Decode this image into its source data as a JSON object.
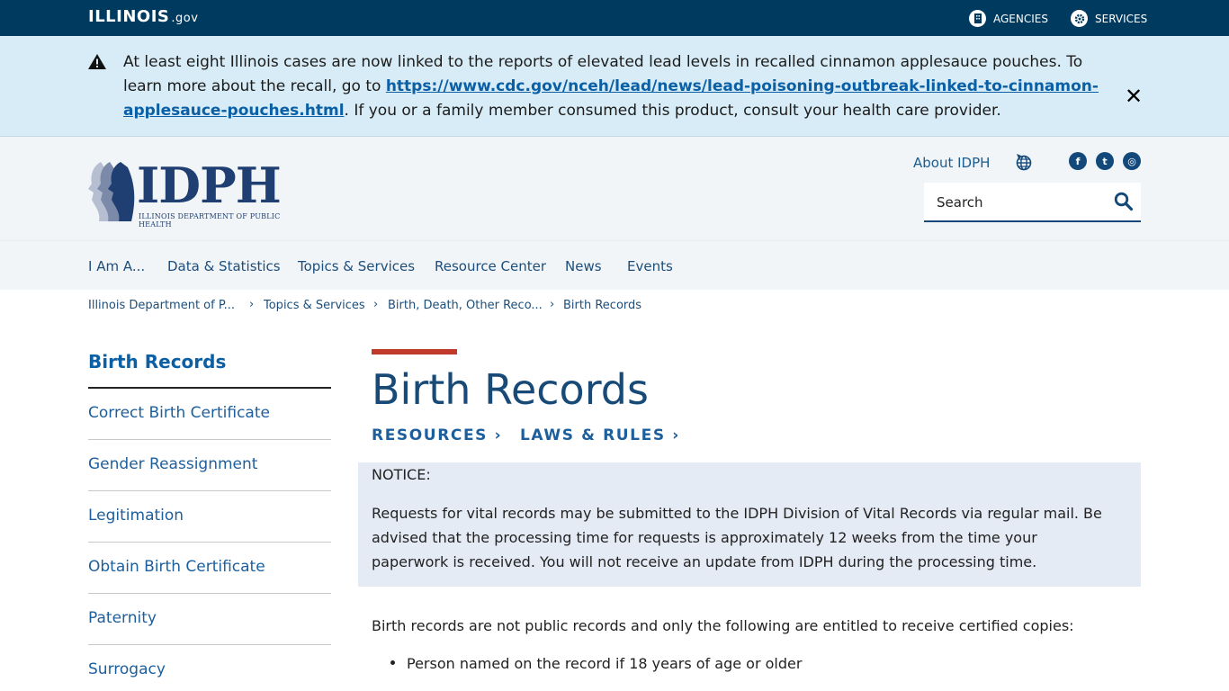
{
  "topbar": {
    "logo_main": "ILLINOIS",
    "logo_suffix": ".gov",
    "agencies_label": "AGENCIES",
    "services_label": "SERVICES"
  },
  "alert": {
    "text_before": "At least eight Illinois cases are now linked to the reports of elevated lead levels in recalled cinnamon applesauce pouches. To learn more about the recall, go to ",
    "link_text": "https://www.cdc.gov/nceh/lead/news/lead-poisoning-outbreak-linked-to-cinnamon-applesauce-pouches.html",
    "text_after": ". If you or a family member consumed this product, consult your health care provider.",
    "close_symbol": "✕"
  },
  "header": {
    "logo_word": "IDPH",
    "logo_sub": "ILLINOIS DEPARTMENT OF PUBLIC HEALTH",
    "about_label": "About IDPH",
    "search_placeholder": "Search",
    "social": {
      "facebook": "f",
      "twitter": "t",
      "instagram": "◎"
    }
  },
  "nav": {
    "items": [
      "I Am A...",
      "Data & Statistics",
      "Topics & Services",
      "Resource Center",
      "News",
      "Events"
    ]
  },
  "breadcrumb": {
    "items": [
      "Illinois Department of P...",
      "Topics & Services",
      "Birth, Death, Other Reco...",
      "Birth Records"
    ],
    "separator": "›"
  },
  "sidebar": {
    "title": "Birth Records",
    "items": [
      "Correct Birth Certificate",
      "Gender Reassignment",
      "Legitimation",
      "Obtain Birth Certificate",
      "Paternity",
      "Surrogacy"
    ]
  },
  "main": {
    "title": "Birth Records",
    "links": [
      "RESOURCES",
      "LAWS & RULES"
    ],
    "link_chevron": "›",
    "notice_heading": "NOTICE:",
    "notice_body": "Requests for vital records may be submitted to the IDPH Division of Vital Records via regular mail. Be advised that the processing time for requests is approximately 12 weeks from the time your paperwork is received. You will not receive an update from IDPH during the processing time.",
    "paragraph": "Birth records are not public records and only the following are entitled to receive certified copies:",
    "bullets": [
      "Person named on the record if 18 years of age or older"
    ]
  },
  "colors": {
    "topbar": "#013a5f",
    "alert_bg": "#d7ecf6",
    "link": "#0b5fa5",
    "accent": "#c0392b",
    "title": "#184a78"
  },
  "icons": {
    "agencies": "building-icon",
    "services": "gear-icon",
    "alert": "warning-icon",
    "close": "close-icon",
    "language": "globe-icon",
    "search": "search-icon"
  }
}
